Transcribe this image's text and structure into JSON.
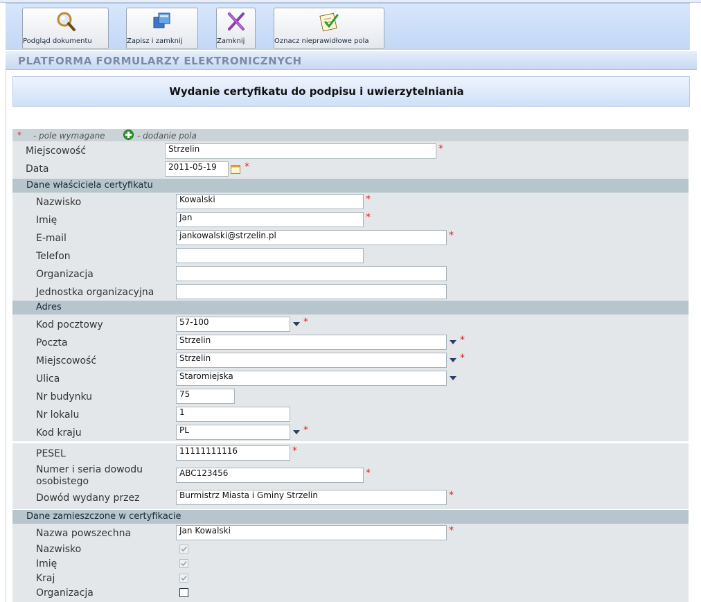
{
  "toolbar": {
    "preview_label": "Podgląd dokumentu",
    "save_close_label": "Zapisz i zamknij",
    "close_label": "Zamknij",
    "mark_invalid_label": "Oznacz nieprawidłowe pola"
  },
  "header": {
    "platform_title": "PLATFORMA FORMULARZY ELEKTRONICZNYCH"
  },
  "form": {
    "title": "Wydanie certyfikatu do podpisu i uwierzytelniania",
    "legend_required": "- pole wymagane",
    "legend_add": "- dodanie pola",
    "required_mark": "*",
    "miejscowosc": {
      "label": "Miejscowość",
      "value": "Strzelin"
    },
    "data": {
      "label": "Data",
      "value": "2011-05-19"
    },
    "owner_section": "Dane właściciela certyfikatu",
    "nazwisko": {
      "label": "Nazwisko",
      "value": "Kowalski"
    },
    "imie": {
      "label": "Imię",
      "value": "Jan"
    },
    "email": {
      "label": "E-mail",
      "value": "jankowalski@strzelin.pl"
    },
    "telefon": {
      "label": "Telefon",
      "value": ""
    },
    "organizacja": {
      "label": "Organizacja",
      "value": ""
    },
    "jednostka": {
      "label": "Jednostka organizacyjna",
      "value": ""
    },
    "address_section": "Adres",
    "kod_pocztowy": {
      "label": "Kod pocztowy",
      "value": "57-100"
    },
    "poczta": {
      "label": "Poczta",
      "value": "Strzelin"
    },
    "miejscowosc_adres": {
      "label": "Miejscowość",
      "value": "Strzelin"
    },
    "ulica": {
      "label": "Ulica",
      "value": "Staromiejska"
    },
    "nr_budynku": {
      "label": "Nr budynku",
      "value": "75"
    },
    "nr_lokalu": {
      "label": "Nr lokalu",
      "value": "1"
    },
    "kod_kraju": {
      "label": "Kod kraju",
      "value": "PL"
    },
    "pesel": {
      "label": "PESEL",
      "value": "11111111116"
    },
    "dowod_numer": {
      "label_line1": "Numer i seria dowodu",
      "label_line2": "osobistego",
      "value": "ABC123456"
    },
    "dowod_wydany": {
      "label": "Dowód wydany przez",
      "value": "Burmistrz Miasta i Gminy Strzelin"
    },
    "cert_section": "Dane zamieszczone w certyfikacie",
    "nazwa_powszechna": {
      "label": "Nazwa powszechna",
      "value": "Jan Kowalski"
    },
    "cert_nazwisko": {
      "label": "Nazwisko",
      "checked": true
    },
    "cert_imie": {
      "label": "Imię",
      "checked": true
    },
    "cert_kraj": {
      "label": "Kraj",
      "checked": true
    },
    "cert_organizacja": {
      "label": "Organizacja",
      "checked": false
    }
  },
  "colors": {
    "required": "#e02020",
    "section_bg": "#b6c6cc",
    "panel_bg": "#e3e7ea"
  }
}
